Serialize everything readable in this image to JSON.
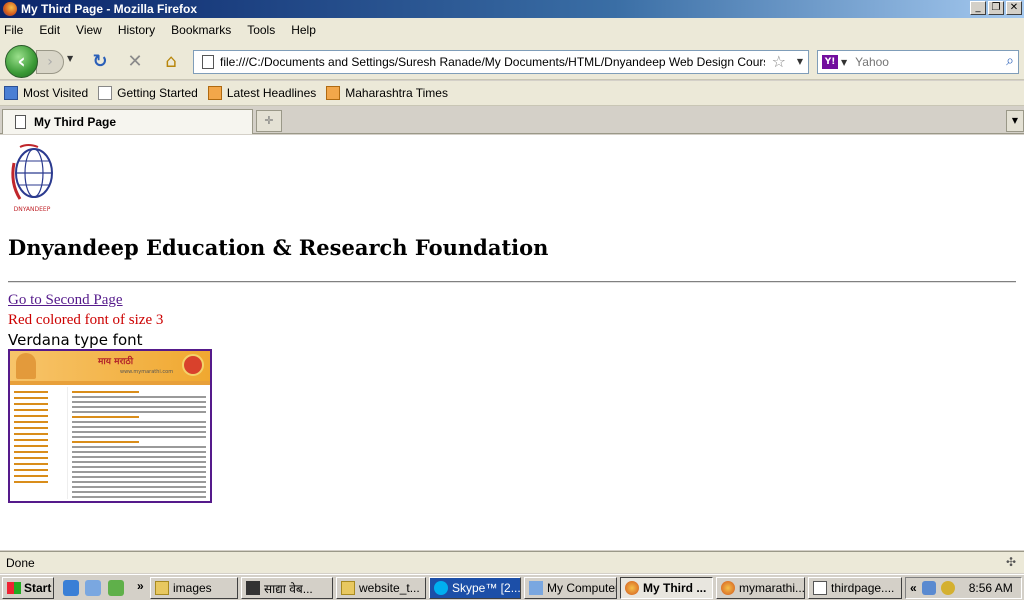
{
  "window": {
    "title": "My Third Page - Mozilla Firefox",
    "buttons": [
      "_",
      "❐",
      "✕"
    ]
  },
  "menu": [
    "File",
    "Edit",
    "View",
    "History",
    "Bookmarks",
    "Tools",
    "Help"
  ],
  "nav": {
    "url": "file:///C:/Documents and Settings/Suresh Ranade/My Documents/HTML/Dnyandeep Web Design Course/thirdpag",
    "search_placeholder": "Yahoo",
    "search_engine_icon": "Y!"
  },
  "bookmarks": [
    "Most Visited",
    "Getting Started",
    "Latest Headlines",
    "Maharashtra Times"
  ],
  "tabs": [
    {
      "label": "My Third Page"
    }
  ],
  "content": {
    "heading": "Dnyandeep Education & Research Foundation",
    "link_text": "Go to Second Page",
    "red_text": "Red colored font of size 3",
    "verdana_text": "Verdana type font",
    "logo_text": "DNYANDEEP",
    "thumb_title": "माय मराठी",
    "thumb_url": "www.mymarathi.com"
  },
  "status": "Done",
  "taskbar": {
    "start_label": "Start",
    "quicklaunch_more": "»",
    "tasks": [
      "images",
      "साद्या वेब...",
      "website_t...",
      "Skype™ [2...",
      "My Computer",
      "My Third ...",
      "mymarathi...",
      "thirdpage...."
    ],
    "tray_more": "«",
    "clock": "8:56 AM"
  },
  "colors": {
    "link_visited": "#551a8b",
    "red_text": "#cc0000",
    "titlebar": "#0a246a"
  }
}
